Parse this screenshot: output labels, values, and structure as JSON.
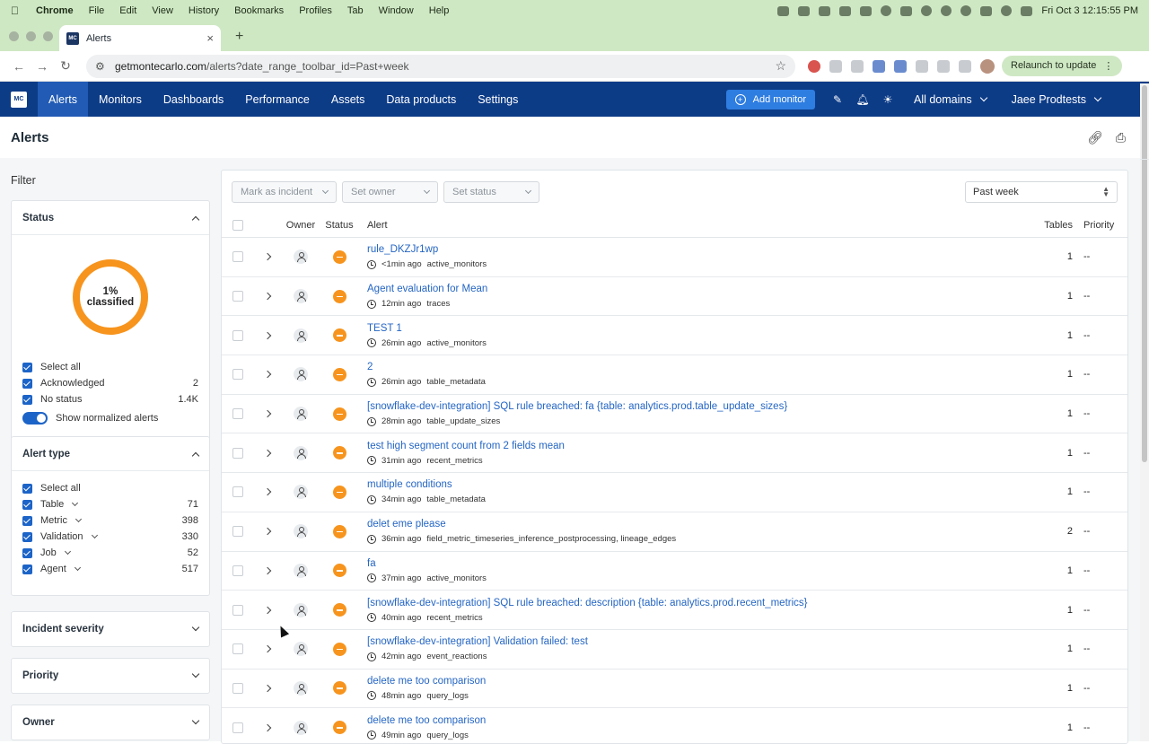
{
  "menubar": {
    "app": "Chrome",
    "items": [
      "File",
      "Edit",
      "View",
      "History",
      "Bookmarks",
      "Profiles",
      "Tab",
      "Window",
      "Help"
    ],
    "clock": "Fri Oct 3  12:15:55 PM"
  },
  "browser": {
    "tab_title": "Alerts",
    "favicon": "MC",
    "url_host": "getmontecarlo.com",
    "url_path": "/alerts?date_range_toolbar_id=Past+week",
    "relaunch": "Relaunch to update"
  },
  "nav": {
    "logo": "MC",
    "items": [
      "Alerts",
      "Monitors",
      "Dashboards",
      "Performance",
      "Assets",
      "Data products",
      "Settings"
    ],
    "active": "Alerts",
    "add_monitor": "Add monitor",
    "domains": "All domains",
    "user": "Jaee Prodtests"
  },
  "page": {
    "title": "Alerts"
  },
  "filter": {
    "title": "Filter",
    "status": {
      "title": "Status",
      "donut_pct": "1%",
      "donut_label": "classified",
      "options": [
        {
          "label": "Select all",
          "count": ""
        },
        {
          "label": "Acknowledged",
          "count": "2"
        },
        {
          "label": "No status",
          "count": "1.4K"
        }
      ],
      "toggle_label": "Show normalized alerts"
    },
    "alert_type": {
      "title": "Alert type",
      "options": [
        {
          "label": "Select all",
          "count": ""
        },
        {
          "label": "Table",
          "count": "71"
        },
        {
          "label": "Metric",
          "count": "398"
        },
        {
          "label": "Validation",
          "count": "330"
        },
        {
          "label": "Job",
          "count": "52"
        },
        {
          "label": "Agent",
          "count": "517"
        }
      ]
    },
    "collapsed": [
      "Incident severity",
      "Priority",
      "Owner"
    ]
  },
  "table": {
    "actions": [
      "Mark as incident",
      "Set owner",
      "Set status"
    ],
    "date_range": "Past week",
    "headers": {
      "owner": "Owner",
      "status": "Status",
      "alert": "Alert",
      "tables": "Tables",
      "priority": "Priority"
    },
    "rows": [
      {
        "title": "rule_DKZJr1wp",
        "ago": "<1min ago",
        "source": "active_monitors",
        "tables": "1",
        "priority": "--"
      },
      {
        "title": "Agent evaluation for Mean",
        "ago": "12min ago",
        "source": "traces",
        "tables": "1",
        "priority": "--"
      },
      {
        "title": "TEST 1",
        "ago": "26min ago",
        "source": "active_monitors",
        "tables": "1",
        "priority": "--"
      },
      {
        "title": "2",
        "ago": "26min ago",
        "source": "table_metadata",
        "tables": "1",
        "priority": "--"
      },
      {
        "title": "[snowflake-dev-integration] SQL rule breached: fa {table: analytics.prod.table_update_sizes}",
        "ago": "28min ago",
        "source": "table_update_sizes",
        "tables": "1",
        "priority": "--"
      },
      {
        "title": "test high segment count from 2 fields mean",
        "ago": "31min ago",
        "source": "recent_metrics",
        "tables": "1",
        "priority": "--"
      },
      {
        "title": "multiple conditions",
        "ago": "34min ago",
        "source": "table_metadata",
        "tables": "1",
        "priority": "--"
      },
      {
        "title": "delet eme please",
        "ago": "36min ago",
        "source": "field_metric_timeseries_inference_postprocessing, lineage_edges",
        "tables": "2",
        "priority": "--"
      },
      {
        "title": "fa",
        "ago": "37min ago",
        "source": "active_monitors",
        "tables": "1",
        "priority": "--"
      },
      {
        "title": "[snowflake-dev-integration] SQL rule breached: description {table: analytics.prod.recent_metrics}",
        "ago": "40min ago",
        "source": "recent_metrics",
        "tables": "1",
        "priority": "--"
      },
      {
        "title": "[snowflake-dev-integration] Validation failed: test",
        "ago": "42min ago",
        "source": "event_reactions",
        "tables": "1",
        "priority": "--"
      },
      {
        "title": "delete me too comparison",
        "ago": "48min ago",
        "source": "query_logs",
        "tables": "1",
        "priority": "--"
      },
      {
        "title": "delete me too comparison",
        "ago": "49min ago",
        "source": "query_logs",
        "tables": "1",
        "priority": "--"
      }
    ]
  }
}
